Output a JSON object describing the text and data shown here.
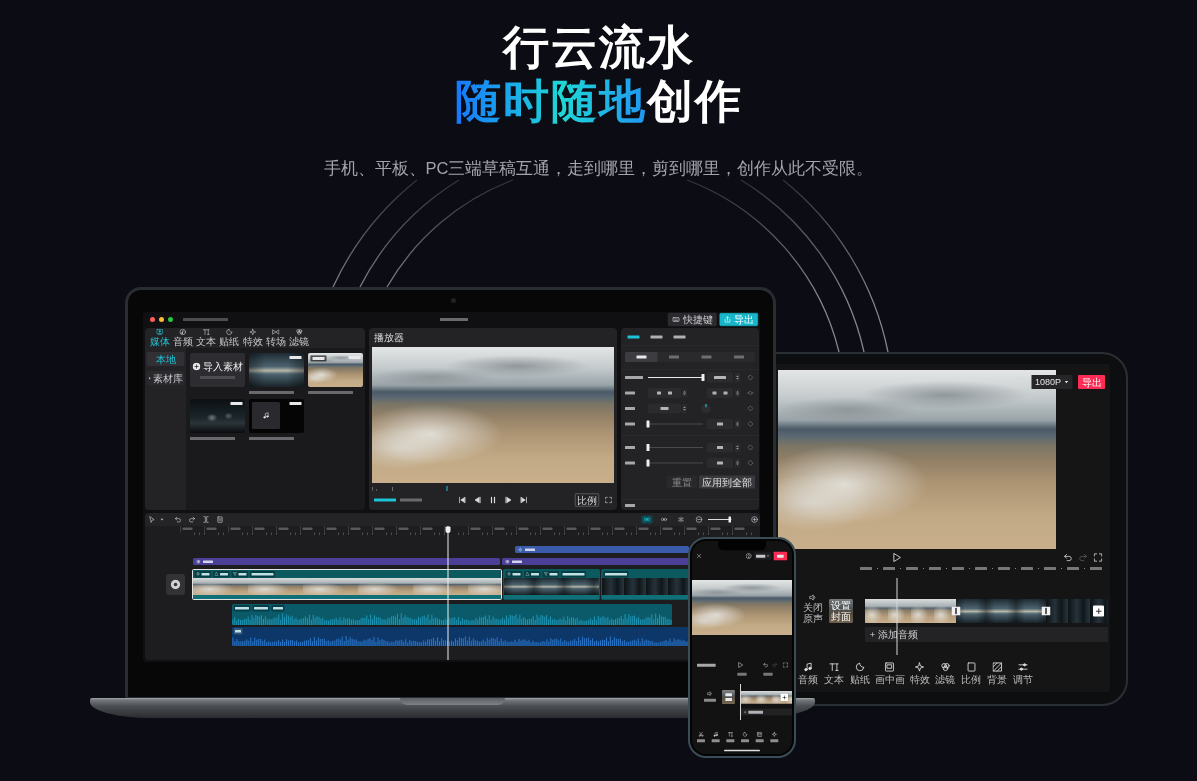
{
  "hero": {
    "title": "行云流水",
    "subtitle_highlight": "随时随地",
    "subtitle_rest": "创作",
    "tagline": "手机、平板、PC三端草稿互通，走到哪里，剪到哪里，创作从此不受限。"
  },
  "laptop": {
    "shortcut_button": "快捷键",
    "export_button": "导出",
    "media_tabs": [
      {
        "label": "媒体",
        "selected": true
      },
      {
        "label": "音频",
        "selected": false
      },
      {
        "label": "文本",
        "selected": false
      },
      {
        "label": "贴纸",
        "selected": false
      },
      {
        "label": "特效",
        "selected": false
      },
      {
        "label": "转场",
        "selected": false
      },
      {
        "label": "滤镜",
        "selected": false
      }
    ],
    "media_sidebar": [
      {
        "label": "本地",
        "kind": "item",
        "selected": true
      },
      {
        "label": "素材库",
        "kind": "folder",
        "selected": false
      }
    ],
    "import_button": "导入素材",
    "media_items": [
      {
        "kind": "video",
        "added": false
      },
      {
        "kind": "video",
        "added": true
      },
      {
        "kind": "video",
        "added": false
      },
      {
        "kind": "audio",
        "added": false
      }
    ],
    "player": {
      "title": "播放器",
      "progress": {
        "level": 0.31
      },
      "ratio_button": "比例"
    },
    "inspector": {
      "tabs": [
        {
          "selected": true
        },
        {
          "selected": false
        },
        {
          "selected": false
        }
      ],
      "subtabs": [
        {
          "selected": true
        },
        {
          "selected": false
        },
        {
          "selected": false
        },
        {
          "selected": false
        }
      ],
      "row_groups": [
        [
          {
            "kind": "slider",
            "level": 1
          },
          {
            "kind": "position"
          },
          {
            "kind": "rotation"
          },
          {
            "kind": "slider",
            "level": 0
          }
        ],
        [
          {
            "kind": "slider",
            "level": 0
          },
          {
            "kind": "slider",
            "level": 0
          }
        ]
      ],
      "buttons": [
        {
          "label": "重置",
          "disabled": true
        },
        {
          "label": "应用到全部",
          "disabled": false
        }
      ]
    },
    "timeline": {
      "toggles": [
        {
          "on": true
        },
        {
          "on": false
        },
        {
          "on": false
        }
      ],
      "zoom": {
        "level": 0.9
      },
      "tracks": [
        {
          "kind": "effect",
          "clips": [
            {
              "selected": false
            }
          ]
        },
        {
          "kind": "filter",
          "clips": [
            {
              "selected": false
            },
            {
              "selected": false
            }
          ]
        },
        {
          "kind": "video",
          "clips": [
            {
              "selected": true
            },
            {
              "selected": false
            },
            {
              "selected": false
            }
          ]
        },
        {
          "kind": "audio",
          "clips": [
            {
              "selected": false
            }
          ]
        },
        {
          "kind": "recording",
          "clips": [
            {
              "selected": false
            }
          ]
        }
      ]
    }
  },
  "tablet": {
    "resolution": "1080P",
    "export_button": "导出",
    "mute_label": "关闭原声",
    "cover_label": "设置封面",
    "add_audio": "添加音频",
    "tools": [
      "音频",
      "文本",
      "贴纸",
      "画中画",
      "特效",
      "滤镜",
      "比例",
      "背景",
      "调节"
    ]
  }
}
